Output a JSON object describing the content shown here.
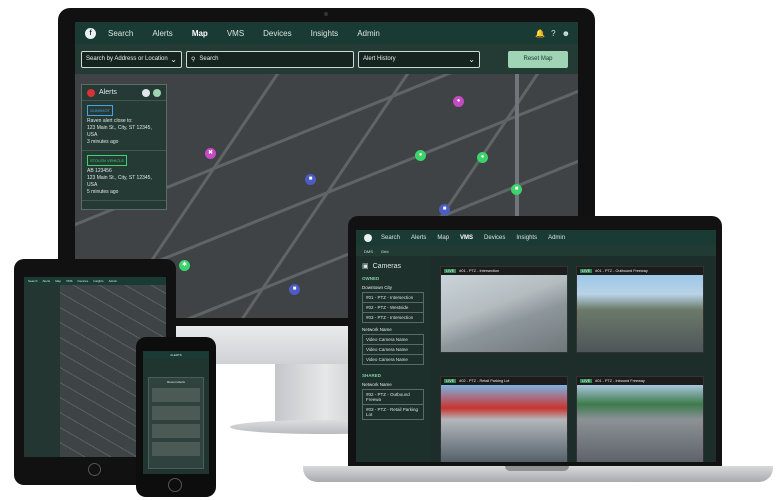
{
  "desktop": {
    "nav": {
      "logo": "f",
      "items": [
        "Search",
        "Alerts",
        "Map",
        "VMS",
        "Devices",
        "Insights",
        "Admin"
      ],
      "active": "Map",
      "icons": [
        "bell-icon",
        "help-icon",
        "user-icon"
      ],
      "help_glyph": "?"
    },
    "toolbar": {
      "search_by_label": "Search by Address or Location",
      "search_placeholder": "Search",
      "history_label": "Alert History",
      "reset_label": "Reset Map"
    },
    "alerts_panel": {
      "title": "Alerts",
      "cards": [
        {
          "badge": "GUNSHOT",
          "badge_color": "#4aa3e8",
          "line1": "Raven alert close to:",
          "line2": "123 Main St., City, ST 12345,",
          "line3": "USA",
          "time": "3 minutes ago"
        },
        {
          "badge": "STOLEN VEHICLE",
          "badge_color": "#3bd36b",
          "line1": "AB 123456",
          "line2": "123 Main St., City, ST 12345,",
          "line3": "USA",
          "time": "5 minutes ago"
        }
      ]
    }
  },
  "laptop": {
    "nav": {
      "items": [
        "Search",
        "Alerts",
        "Map",
        "VMS",
        "Devices",
        "Insights",
        "Admin"
      ],
      "active": "VMS"
    },
    "subtabs": [
      "DMS",
      "Grid"
    ],
    "sidebar": {
      "title": "Cameras",
      "owned_label": "OWNED",
      "owned_group": "Downtown City",
      "owned_items": [
        "#01 - PTZ - Intersection",
        "#02 - PTZ - Westside",
        "#03 - PTZ - Intersection"
      ],
      "network_label": "Network Name",
      "network_items": [
        "Video Camera Name",
        "Video Camera Name",
        "Video Camera Name"
      ],
      "shared_label": "SHARED",
      "shared_group": "Network Name",
      "shared_items": [
        "#02 - PTZ - Outbound Freewa",
        "#03 - PTZ - Retail Parking Lot"
      ]
    },
    "tiles": [
      {
        "title": "#01 - PTZ - Intersection",
        "live": "LIVE"
      },
      {
        "title": "#01 - PTZ - Outbound Freeway",
        "live": "LIVE"
      },
      {
        "title": "#02 - PTZ - Retail Parking Lot",
        "live": "LIVE"
      },
      {
        "title": "#01 - PTZ - Inbound Freeway",
        "live": "LIVE"
      }
    ]
  },
  "tablet": {
    "nav": [
      "Search",
      "Alerts",
      "Map",
      "VMS",
      "Devices",
      "Insights",
      "Admin"
    ]
  },
  "phone": {
    "nav_title": "ALERTS",
    "panel_title": "Recent Alerts"
  }
}
